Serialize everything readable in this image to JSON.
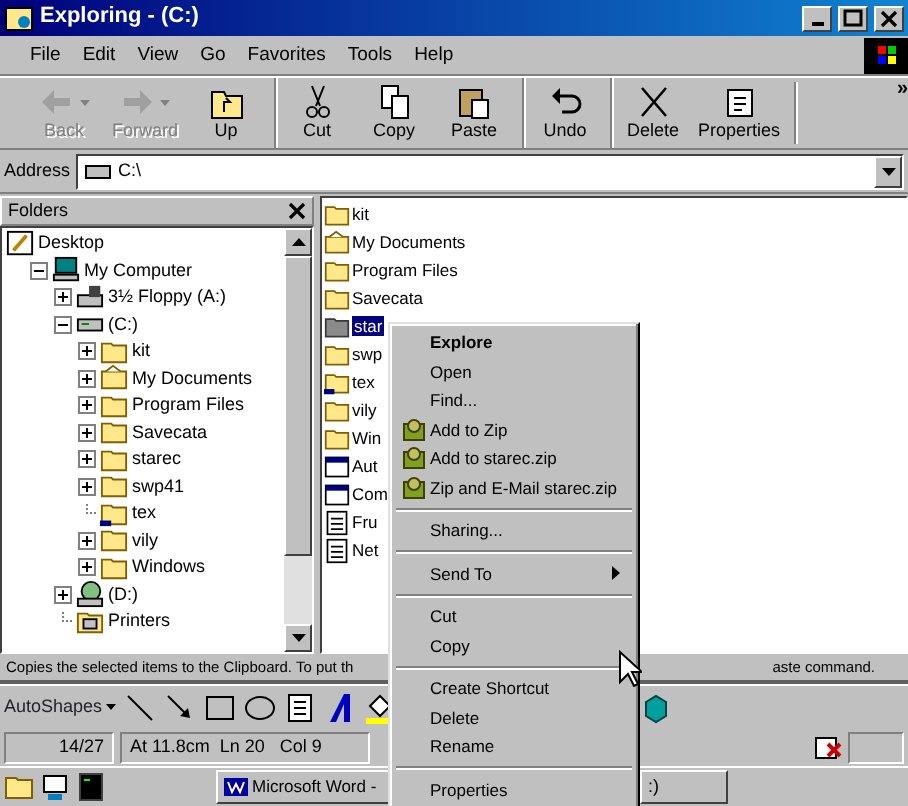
{
  "window": {
    "title": "Exploring -  (C:)"
  },
  "menu_bar": [
    "File",
    "Edit",
    "View",
    "Go",
    "Favorites",
    "Tools",
    "Help"
  ],
  "toolbar": [
    {
      "label": "Back",
      "kind": "back",
      "disabled": true,
      "dropdown": true,
      "separator_before": false
    },
    {
      "label": "Forward",
      "kind": "forward",
      "disabled": true,
      "dropdown": true,
      "separator_before": false
    },
    {
      "label": "Up",
      "kind": "up",
      "disabled": false,
      "dropdown": false,
      "separator_before": false
    },
    {
      "label": "Cut",
      "kind": "cut",
      "disabled": false,
      "dropdown": false,
      "separator_before": true
    },
    {
      "label": "Copy",
      "kind": "copy",
      "disabled": false,
      "dropdown": false,
      "separator_before": false
    },
    {
      "label": "Paste",
      "kind": "paste",
      "disabled": false,
      "dropdown": false,
      "separator_before": false
    },
    {
      "label": "Undo",
      "kind": "undo",
      "disabled": false,
      "dropdown": false,
      "separator_before": true
    },
    {
      "label": "Delete",
      "kind": "delete",
      "disabled": false,
      "dropdown": false,
      "separator_before": true
    },
    {
      "label": "Properties",
      "kind": "properties",
      "disabled": false,
      "dropdown": false,
      "separator_before": false
    }
  ],
  "toolbar_more": "»",
  "address": {
    "label": "Address",
    "value": "C:\\"
  },
  "folders_pane": {
    "title": "Folders",
    "tree": [
      {
        "label": "Desktop",
        "kind": "desktop",
        "expandable": false,
        "children": [
          {
            "label": "My Computer",
            "kind": "computer",
            "expandable": true,
            "expanded": true,
            "children": [
              {
                "label": "3½ Floppy (A:)",
                "kind": "floppy",
                "expandable": true,
                "expanded": false
              },
              {
                "label": "(C:)",
                "kind": "drive",
                "expandable": true,
                "expanded": true,
                "children": [
                  {
                    "label": "kit",
                    "kind": "folder",
                    "expandable": true,
                    "expanded": false
                  },
                  {
                    "label": "My Documents",
                    "kind": "mydocs",
                    "expandable": true,
                    "expanded": false
                  },
                  {
                    "label": "Program Files",
                    "kind": "folder",
                    "expandable": true,
                    "expanded": false
                  },
                  {
                    "label": "Savecata",
                    "kind": "folder",
                    "expandable": true,
                    "expanded": false
                  },
                  {
                    "label": "starec",
                    "kind": "folder",
                    "expandable": true,
                    "expanded": false
                  },
                  {
                    "label": "swp41",
                    "kind": "folder",
                    "expandable": true,
                    "expanded": false
                  },
                  {
                    "label": "tex",
                    "kind": "shared",
                    "expandable": false
                  },
                  {
                    "label": "vily",
                    "kind": "folder",
                    "expandable": true,
                    "expanded": false
                  },
                  {
                    "label": "Windows",
                    "kind": "folder",
                    "expandable": true,
                    "expanded": false
                  }
                ]
              },
              {
                "label": "(D:)",
                "kind": "cdrom",
                "expandable": true,
                "expanded": false
              },
              {
                "label": "Printers",
                "kind": "printers",
                "expandable": false
              }
            ]
          }
        ]
      }
    ]
  },
  "files": [
    {
      "label": "kit",
      "kind": "folder",
      "selected": false
    },
    {
      "label": "My Documents",
      "kind": "mydocs",
      "selected": false
    },
    {
      "label": "Program Files",
      "kind": "folder",
      "selected": false
    },
    {
      "label": "Savecata",
      "kind": "folder",
      "selected": false
    },
    {
      "label": "star",
      "kind": "folder",
      "selected": true
    },
    {
      "label": "swp",
      "kind": "folder",
      "selected": false
    },
    {
      "label": "tex",
      "kind": "shared",
      "selected": false
    },
    {
      "label": "vily",
      "kind": "folder",
      "selected": false
    },
    {
      "label": "Win",
      "kind": "folder",
      "selected": false
    },
    {
      "label": "Aut",
      "kind": "window",
      "selected": false
    },
    {
      "label": "Com",
      "kind": "window",
      "selected": false
    },
    {
      "label": "Fru",
      "kind": "doc",
      "selected": false
    },
    {
      "label": "Net",
      "kind": "doc",
      "selected": false
    }
  ],
  "status_bar": [
    "Copies the selected items to the Clipboard. To put th",
    "aste command."
  ],
  "context_menu": [
    {
      "label": "Explore",
      "kind": "default"
    },
    {
      "label": "Open",
      "kind": "item"
    },
    {
      "label": "Find...",
      "kind": "item"
    },
    {
      "label": "Add to Zip",
      "kind": "zip"
    },
    {
      "label": "Add to starec.zip",
      "kind": "zip"
    },
    {
      "label": "Zip and E-Mail starec.zip",
      "kind": "zip"
    },
    {
      "kind": "separator"
    },
    {
      "label": "Sharing...",
      "kind": "item"
    },
    {
      "kind": "separator"
    },
    {
      "label": "Send To",
      "kind": "submenu"
    },
    {
      "kind": "separator"
    },
    {
      "label": "Cut",
      "kind": "item"
    },
    {
      "label": "Copy",
      "kind": "item"
    },
    {
      "kind": "separator"
    },
    {
      "label": "Create Shortcut",
      "kind": "item"
    },
    {
      "label": "Delete",
      "kind": "item"
    },
    {
      "label": "Rename",
      "kind": "item"
    },
    {
      "kind": "separator"
    },
    {
      "label": "Properties",
      "kind": "item"
    }
  ],
  "word_drawing_toolbar": {
    "autoshapes": "AutoShapes"
  },
  "word_status": {
    "page": "14/27",
    "position": "At 11.8cm  Ln 20   Col 9"
  },
  "taskbar": {
    "buttons": [
      "Microsoft Word -",
      ":)"
    ]
  }
}
